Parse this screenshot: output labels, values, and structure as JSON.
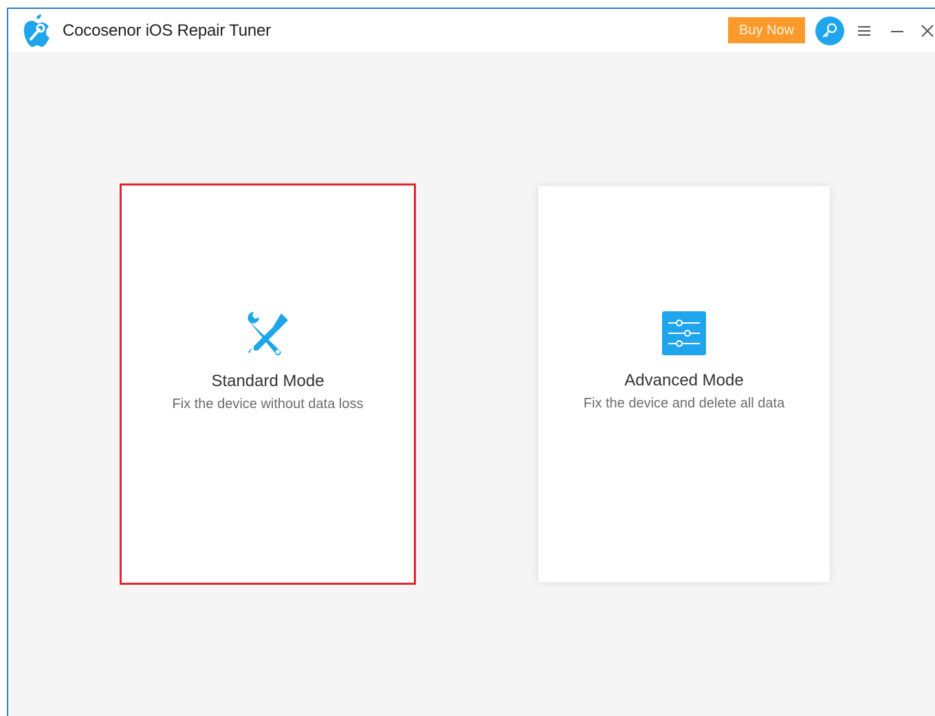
{
  "app": {
    "title": "Cocosenor iOS Repair Tuner",
    "logo_icon": "apple-repair-logo-icon"
  },
  "header": {
    "buy_now_label": "Buy Now",
    "key_icon": "key-icon",
    "menu_icon": "hamburger-menu-icon",
    "minimize_icon": "minimize-icon",
    "close_icon": "close-icon"
  },
  "modes": [
    {
      "title": "Standard Mode",
      "description": "Fix the device without data loss",
      "icon": "wrench-screwdriver-icon",
      "selected": true
    },
    {
      "title": "Advanced Mode",
      "description": "Fix the device and delete all data",
      "icon": "sliders-icon",
      "selected": false
    }
  ],
  "colors": {
    "accent_blue": "#1ea5ec",
    "buy_now_orange": "#fb9a2a",
    "selected_border_red": "#e0262e",
    "window_border_blue": "#2f7fd1"
  }
}
